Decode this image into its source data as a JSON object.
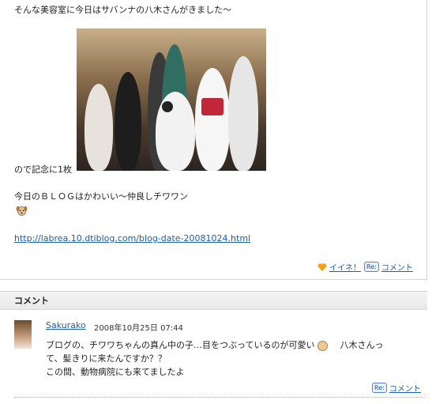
{
  "post": {
    "line1": "そんな美容室に今日はサバンナの八木さんがきました〜",
    "caption_left": "ので記念に1枚",
    "line2": "今日のＢＬＯＧはかわいい〜仲良しチワワン",
    "link_url": "http://labrea.10.dtiblog.com/blog-date-20081024.html",
    "like_label": "イイネ！",
    "comment_label": "コメント"
  },
  "comments_section": {
    "header": "コメント",
    "items": [
      {
        "author": "Sakurako",
        "date": "2008年10月25日 07:44",
        "body_line1a": "ブログの、チワワちゃんの真ん中の子…目をつぶっているのが可愛い",
        "body_line1b": "八木さんっ",
        "body_line2": "て、髪きりに来たんですか？？",
        "body_line3": "この間、動物病院にも来てましたよ",
        "reply_label": "コメント"
      }
    ]
  },
  "icons": {
    "dog": "dog-face-icon",
    "like": "like-heart-icon",
    "reply": "re-reply-icon",
    "smile": "smile-face-icon"
  }
}
